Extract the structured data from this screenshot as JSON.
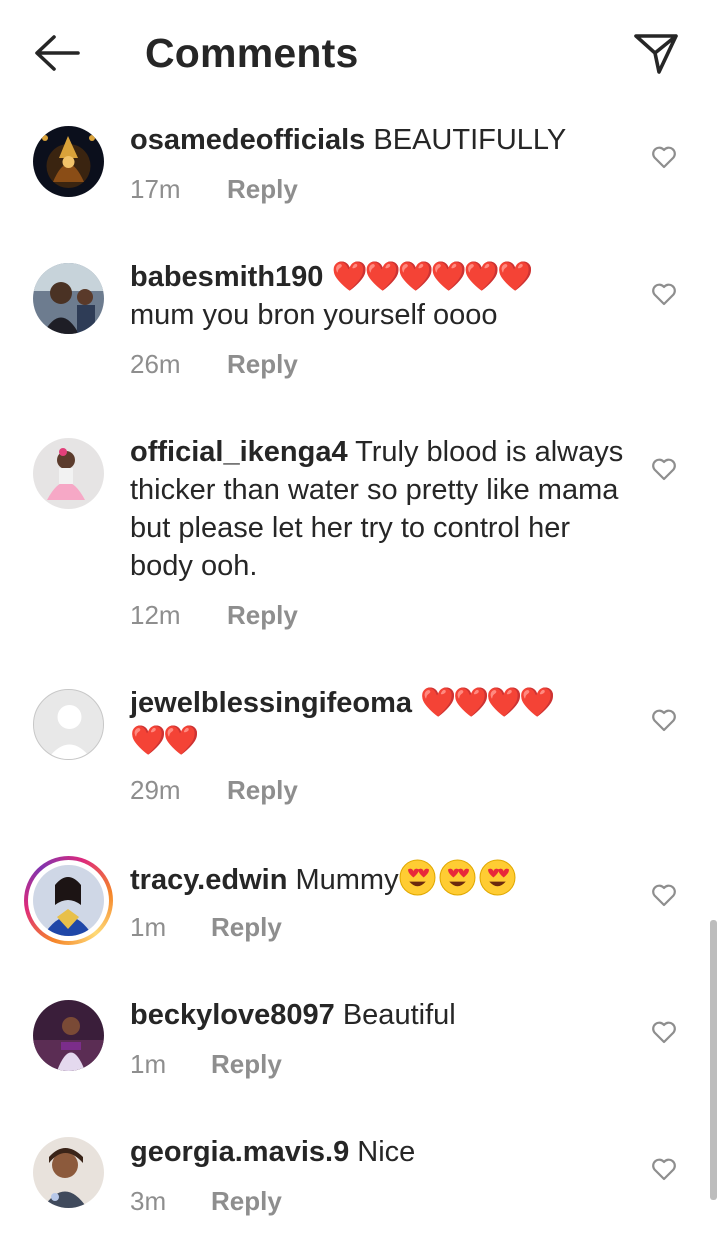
{
  "header": {
    "title": "Comments",
    "back_icon": "arrow-left-icon",
    "send_icon": "paper-plane-icon"
  },
  "comments": [
    {
      "username": "osamedeofficials",
      "text": " BEAUTIFULLY",
      "time": "17m",
      "reply": "Reply"
    },
    {
      "username": "babesmith190",
      "hearts": "❤️❤️❤️❤️❤️❤️",
      "text": "mum you bron yourself oooo",
      "time": "26m",
      "reply": "Reply"
    },
    {
      "username": "official_ikenga4",
      "text": " Truly blood is always thicker than water so pretty like mama but please let her try to control her body ooh.",
      "time": "12m",
      "reply": "Reply"
    },
    {
      "username": "jewelblessingifeoma",
      "hearts": "❤️❤️❤️❤️",
      "hearts2": "❤️❤️",
      "time": "29m",
      "reply": "Reply"
    },
    {
      "username": "tracy.edwin",
      "text": " Mummy",
      "time": "1m",
      "reply": "Reply"
    },
    {
      "username": "beckylove8097",
      "text": " Beautiful",
      "time": "1m",
      "reply": "Reply"
    },
    {
      "username": "georgia.mavis.9",
      "text": " Nice",
      "time": "3m",
      "reply": "Reply"
    }
  ],
  "colors": {
    "text": "#262626",
    "secondary": "#8e8e8e",
    "heart": "#e0162b",
    "story_ring": "#dd2a7b"
  }
}
